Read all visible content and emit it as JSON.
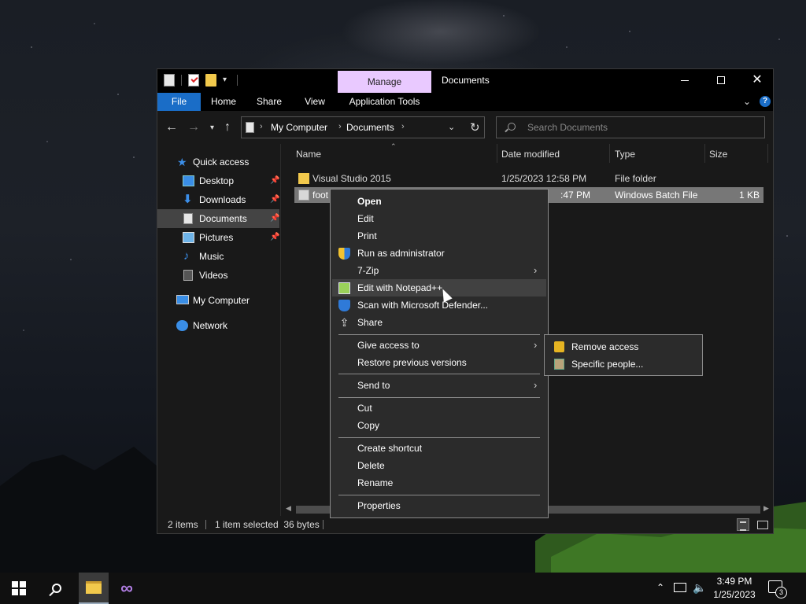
{
  "window": {
    "title": "Documents",
    "contextual_tab_header": "Manage",
    "ribbon_tabs": {
      "file": "File",
      "home": "Home",
      "share": "Share",
      "view": "View",
      "app_tools": "Application Tools"
    },
    "help": "?"
  },
  "address": {
    "crumbs": [
      "My Computer",
      "Documents"
    ],
    "search_placeholder": "Search Documents"
  },
  "navpane": {
    "items": [
      {
        "label": "Quick access",
        "icon": "star-icon"
      },
      {
        "label": "Desktop",
        "icon": "desktop-icon",
        "pinned": true
      },
      {
        "label": "Downloads",
        "icon": "download-icon",
        "pinned": true
      },
      {
        "label": "Documents",
        "icon": "documents-icon",
        "pinned": true,
        "selected": true
      },
      {
        "label": "Pictures",
        "icon": "pictures-icon",
        "pinned": true
      },
      {
        "label": "Music",
        "icon": "music-icon"
      },
      {
        "label": "Videos",
        "icon": "videos-icon"
      },
      {
        "label": "My Computer",
        "icon": "computer-icon"
      },
      {
        "label": "Network",
        "icon": "network-icon"
      }
    ]
  },
  "columns": {
    "name": "Name",
    "date_modified": "Date modified",
    "type": "Type",
    "size": "Size"
  },
  "files": [
    {
      "name": "Visual Studio 2015",
      "date_modified": "1/25/2023 12:58 PM",
      "type": "File folder",
      "size": ""
    },
    {
      "name": "foot",
      "date_modified": ":47 PM",
      "type": "Windows Batch File",
      "size": "1 KB",
      "selected": true
    }
  ],
  "status": {
    "items": "2 items",
    "selected": "1 item selected  36 bytes"
  },
  "context_menu": {
    "open": "Open",
    "edit": "Edit",
    "print": "Print",
    "run_as_admin": "Run as administrator",
    "seven_zip": "7-Zip",
    "edit_npp": "Edit with Notepad++",
    "scan_defender": "Scan with Microsoft Defender...",
    "share": "Share",
    "give_access": "Give access to",
    "restore": "Restore previous versions",
    "send_to": "Send to",
    "cut": "Cut",
    "copy": "Copy",
    "create_shortcut": "Create shortcut",
    "delete": "Delete",
    "rename": "Rename",
    "properties": "Properties"
  },
  "submenu": {
    "remove_access": "Remove access",
    "specific_people": "Specific people..."
  },
  "taskbar": {
    "time": "3:49 PM",
    "date": "1/25/2023",
    "notifications": "3"
  },
  "colors": {
    "file_tab": "#1a6dc7",
    "manage_tab": "#e9c9ff",
    "selection": "#777777",
    "menu_bg": "#2b2b2b"
  }
}
